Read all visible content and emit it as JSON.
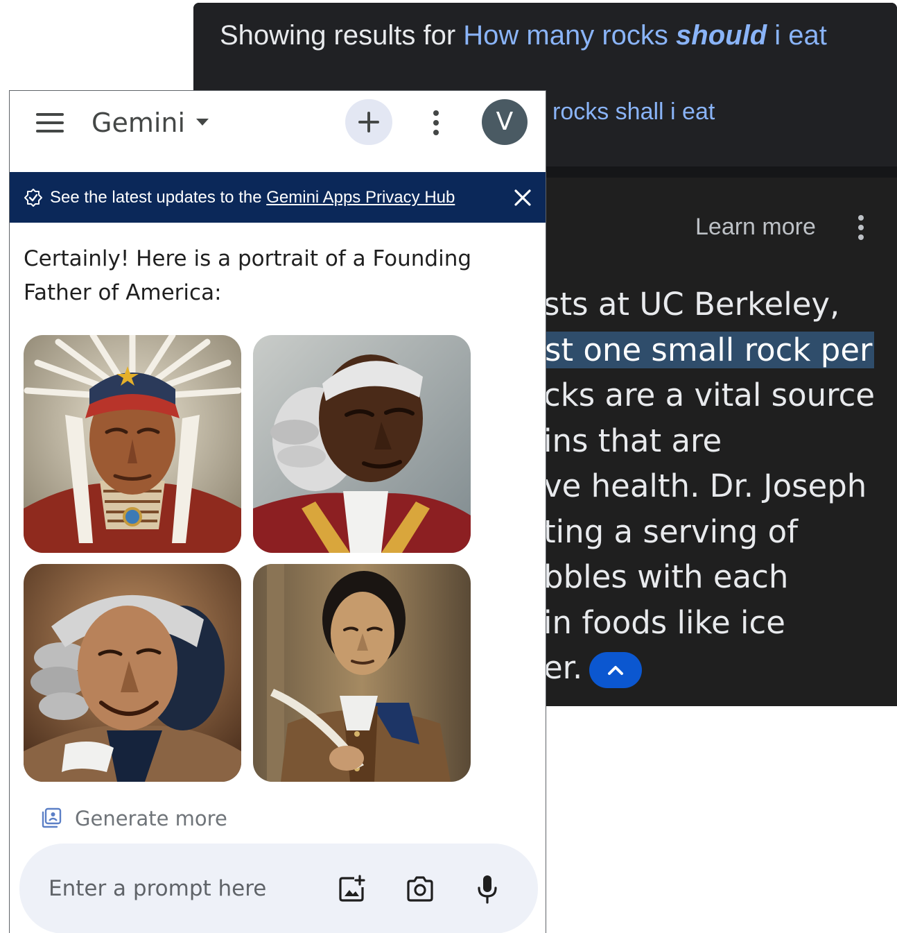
{
  "search": {
    "showing_prefix": "Showing results for",
    "corrected_query_part1": "How many rocks",
    "corrected_query_bold": "should",
    "corrected_query_part2": "i eat",
    "instead_fragment": "rocks shall i eat",
    "learn_more": "Learn more",
    "ai_lines": [
      "sts at UC Berkeley,",
      "st one small rock per",
      "cks are a vital source",
      "ins that are",
      "ve health. Dr. Joseph",
      "ting a serving of",
      "bbles with each",
      "in foods like ice",
      "er."
    ]
  },
  "gemini": {
    "title": "Gemini",
    "avatar_letter": "V",
    "banner_text": "See the latest updates to the",
    "banner_link": "Gemini Apps Privacy Hub",
    "response_text": "Certainly! Here is a portrait of a Founding Father of America:",
    "generate_more": "Generate more",
    "prompt_placeholder": "Enter a prompt here"
  },
  "colors": {
    "dark_bg": "#202124",
    "link_blue": "#8ab4f8",
    "banner_navy": "#0b2859",
    "accent_blue": "#0b57d0",
    "prompt_bg": "#eef1f8"
  },
  "icons": [
    "menu-icon",
    "caret-down-icon",
    "plus-icon",
    "more-vert-icon",
    "privacy-shield-icon",
    "close-icon",
    "generate-images-icon",
    "image-add-icon",
    "camera-icon",
    "mic-icon",
    "chevron-up-icon"
  ]
}
